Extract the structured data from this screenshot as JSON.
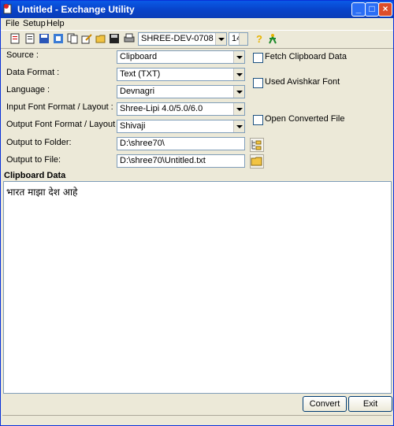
{
  "window": {
    "title": "Untitled - Exchange Utility"
  },
  "menu": [
    {
      "label": "File",
      "key": "F"
    },
    {
      "label": "Setup",
      "key": "S"
    },
    {
      "label": "Help",
      "key": "H"
    }
  ],
  "toolbar": {
    "font_combo": "SHREE-DEV-0708",
    "font_size": "14"
  },
  "form": {
    "source": {
      "label": "Source :",
      "value": "Clipboard"
    },
    "data_format": {
      "label": "Data Format :",
      "value": "Text (TXT)"
    },
    "language": {
      "label": "Language :",
      "value": "Devnagri"
    },
    "input_font": {
      "label": "Input Font Format / Layout :",
      "value": "Shree-Lipi 4.0/5.0/6.0"
    },
    "output_font": {
      "label": "Output Font Format / Layout :",
      "value": "Shivaji"
    },
    "output_folder": {
      "label": "Output to Folder:",
      "value": "D:\\shree70\\"
    },
    "output_file": {
      "label": "Output to File:",
      "value": "D:\\shree70\\Untitled.txt"
    }
  },
  "options": {
    "fetch_clipboard": "Fetch Clipboard Data",
    "used_avishkar": "Used  Avishkar Font",
    "open_converted": "Open Converted File"
  },
  "clipboard": {
    "title": "Clipboard Data",
    "content": "भारत माझा देश आहे"
  },
  "buttons": {
    "convert": "Convert",
    "exit": "Exit"
  }
}
